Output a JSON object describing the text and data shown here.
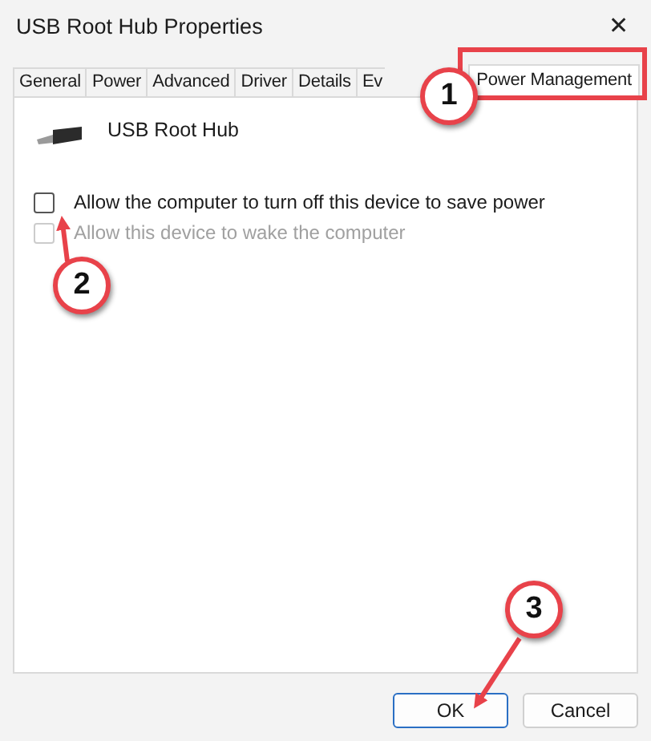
{
  "window": {
    "title": "USB Root Hub Properties",
    "close": "✕"
  },
  "tabs": [
    {
      "label": "General",
      "selected": false
    },
    {
      "label": "Power",
      "selected": false
    },
    {
      "label": "Advanced",
      "selected": false
    },
    {
      "label": "Driver",
      "selected": false
    },
    {
      "label": "Details",
      "selected": false
    },
    {
      "label": "Ev",
      "selected": false
    },
    {
      "label": "Power Management",
      "selected": true
    }
  ],
  "device": {
    "name": "USB Root Hub"
  },
  "options": [
    {
      "label": "Allow the computer to turn off this device to save power",
      "checked": false,
      "disabled": false
    },
    {
      "label": "Allow this device to wake the computer",
      "checked": false,
      "disabled": true
    }
  ],
  "buttons": [
    {
      "label": "OK",
      "default": true
    },
    {
      "label": "Cancel",
      "default": false
    }
  ],
  "annotations": [
    {
      "label": "1",
      "kind": "box"
    },
    {
      "label": "2",
      "kind": "arrow"
    },
    {
      "label": "3",
      "kind": "arrow"
    }
  ]
}
